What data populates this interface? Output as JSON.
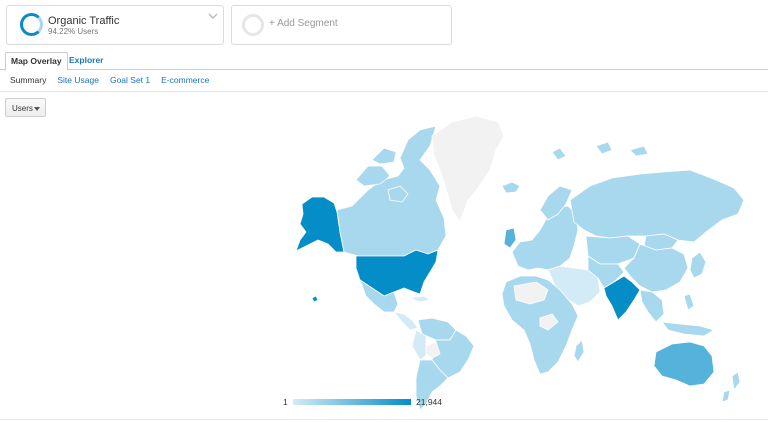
{
  "segments": {
    "active": {
      "name": "Organic Traffic",
      "detail": "94.22% Users"
    },
    "add_label": "+ Add Segment"
  },
  "tabs": [
    {
      "label": "Map Overlay",
      "active": true
    },
    {
      "label": "Explorer",
      "active": false
    }
  ],
  "sub_nav": [
    {
      "label": "Summary",
      "current": true
    },
    {
      "label": "Site Usage",
      "current": false
    },
    {
      "label": "Goal Set 1",
      "current": false
    },
    {
      "label": "E-commerce",
      "current": false
    }
  ],
  "metric_select": {
    "selected": "Users"
  },
  "map": {
    "legend_min": "1",
    "legend_max": "21,944",
    "colors": {
      "low": "#d3ebf7",
      "light": "#a8d8ee",
      "mid": "#54b2db",
      "high": "#058dc7",
      "no_data": "#f2f2f2",
      "border": "#ffffff"
    },
    "highlighted_regions": [
      "United States",
      "India"
    ]
  }
}
